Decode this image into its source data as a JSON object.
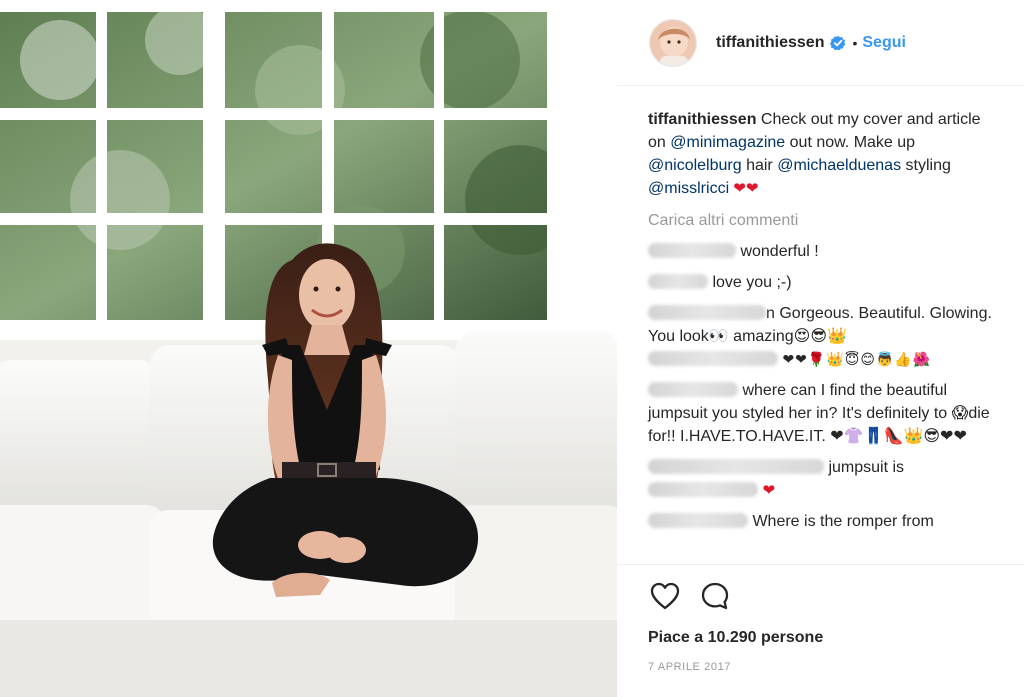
{
  "post": {
    "username": "tiffanithiessen",
    "follow_label": "Segui",
    "separator": "•",
    "verified_icon": "verified-badge-icon",
    "accent": "#3897f0"
  },
  "caption": {
    "username": "tiffanithiessen",
    "t1": " Check out my cover and article on ",
    "m1": "@minimagazine",
    "t2": " out now. Make up ",
    "m2": "@nicolelburg",
    "t3": " hair ",
    "m3": "@michaelduenas",
    "t4": " styling ",
    "m4": "@misslricci",
    "t5": " ❤❤"
  },
  "load_more": "Carica altri commenti",
  "comments": [
    {
      "text": " wonderful !"
    },
    {
      "text": " love you ;-)"
    },
    {
      "text": "n Gorgeous. Beautiful. Glowing. You look👀 amazing😍😎👑",
      "emoji_tail": "❤❤🌹👑😇😊👼👍🌺"
    },
    {
      "text": " where can I find the beautiful jumpsuit you styled her in? It's definitely to 😱die for!! I.HAVE.TO.HAVE.IT. ❤👚👖👠👑😎❤❤"
    },
    {
      "text": " jumpsuit is",
      "tail": "❤"
    },
    {
      "text": " Where is the romper from"
    }
  ],
  "likes_text": "Piace a 10.290 persone",
  "date": "7 APRILE 2017",
  "icons": [
    "heart-outline-icon",
    "comment-bubble-icon"
  ]
}
